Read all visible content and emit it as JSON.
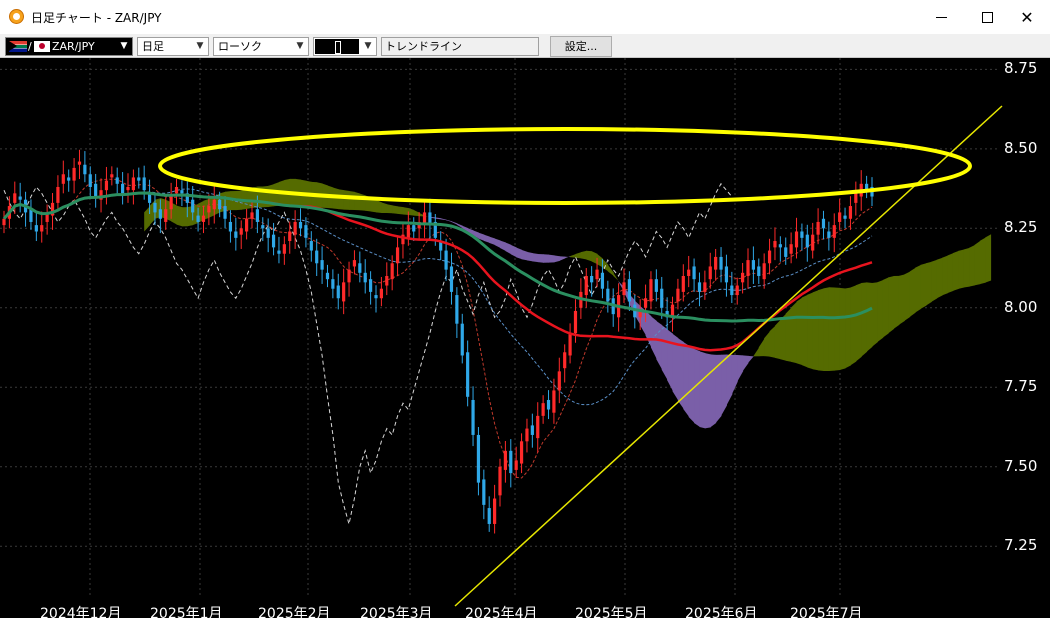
{
  "window": {
    "title": "日足チャート - ZAR/JPY"
  },
  "toolbar": {
    "symbol": "ZAR/JPY",
    "timeframe": "日足",
    "chart_type": "ローソク",
    "indicator_text": "トレンドライン",
    "settings_label": "設定..."
  },
  "colors": {
    "background": "#000000",
    "bull_candle": "#ff2a2a",
    "bear_candle": "#2fa8e8",
    "ma_short": "#e8141e",
    "ma_long": "#2b8f60",
    "cloud_bull": "#556b00",
    "cloud_bear": "#7a5fa8",
    "trendline": "#e6e600",
    "highlight_ellipse": "#ffff00"
  },
  "chart_data": {
    "type": "candlestick",
    "ylim": [
      7.15,
      8.77
    ],
    "y_ticks": [
      "8.75",
      "8.50",
      "8.25",
      "8.00",
      "7.75",
      "7.50",
      "7.25"
    ],
    "x_ticks": [
      "2024年12月",
      "2025年1月",
      "2025年2月",
      "2025年3月",
      "2025年4月",
      "2025年5月",
      "2025年6月",
      "2025年7月"
    ],
    "closes": [
      8.28,
      8.32,
      8.36,
      8.34,
      8.3,
      8.27,
      8.24,
      8.26,
      8.3,
      8.33,
      8.38,
      8.42,
      8.4,
      8.44,
      8.46,
      8.42,
      8.38,
      8.35,
      8.37,
      8.4,
      8.42,
      8.39,
      8.36,
      8.38,
      8.41,
      8.4,
      8.37,
      8.33,
      8.3,
      8.28,
      8.31,
      8.35,
      8.38,
      8.36,
      8.33,
      8.3,
      8.27,
      8.29,
      8.32,
      8.34,
      8.31,
      8.28,
      8.24,
      8.22,
      8.25,
      8.28,
      8.3,
      8.27,
      8.25,
      8.22,
      8.19,
      8.17,
      8.2,
      8.24,
      8.27,
      8.25,
      8.22,
      8.18,
      8.14,
      8.12,
      8.09,
      8.06,
      8.03,
      8.08,
      8.12,
      8.15,
      8.11,
      8.08,
      8.05,
      8.03,
      8.06,
      8.1,
      8.14,
      8.19,
      8.23,
      8.26,
      8.24,
      8.27,
      8.3,
      8.26,
      8.22,
      8.18,
      8.12,
      8.05,
      7.95,
      7.85,
      7.72,
      7.6,
      7.45,
      7.38,
      7.32,
      7.4,
      7.5,
      7.55,
      7.48,
      7.52,
      7.58,
      7.62,
      7.6,
      7.66,
      7.7,
      7.68,
      7.74,
      7.8,
      7.86,
      7.92,
      7.99,
      8.05,
      8.1,
      8.08,
      8.12,
      8.06,
      8.02,
      7.98,
      8.04,
      8.08,
      8.02,
      7.97,
      7.99,
      8.03,
      8.09,
      8.05,
      8.0,
      7.97,
      8.01,
      8.06,
      8.1,
      8.12,
      8.09,
      8.05,
      8.08,
      8.13,
      8.16,
      8.12,
      8.08,
      8.04,
      8.07,
      8.11,
      8.15,
      8.12,
      8.1,
      8.14,
      8.18,
      8.21,
      8.19,
      8.16,
      8.2,
      8.24,
      8.22,
      8.19,
      8.23,
      8.27,
      8.25,
      8.22,
      8.26,
      8.3,
      8.28,
      8.32,
      8.36,
      8.39,
      8.37,
      8.35
    ]
  }
}
